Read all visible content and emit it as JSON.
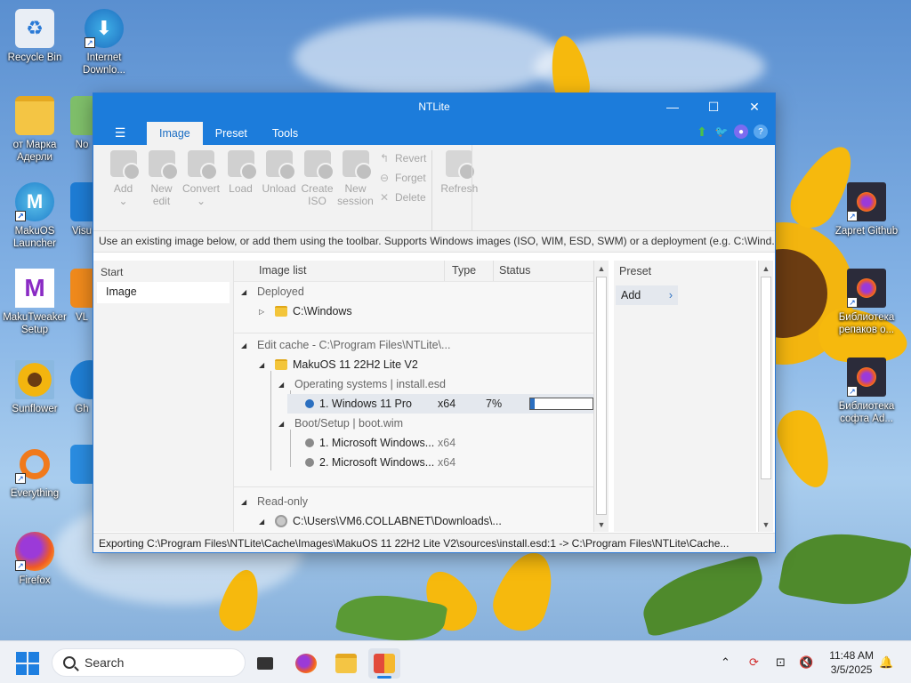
{
  "desktop": {
    "icons_left": [
      {
        "label": "Recycle Bin",
        "icon": "recycle-bin-icon"
      },
      {
        "label": "Internet Downlo...",
        "icon": "internet-download-manager-icon"
      },
      {
        "label": "от Марка Адерли",
        "icon": "folder-icon"
      },
      {
        "label": "No",
        "icon": "notepad-icon"
      },
      {
        "label": "MakuOS Launcher",
        "icon": "makuos-launcher-icon"
      },
      {
        "label": "Visu",
        "icon": "visual-studio-icon"
      },
      {
        "label": "MakuTweaker Setup",
        "icon": "makutweaker-icon"
      },
      {
        "label": "VL",
        "icon": "vlc-icon"
      },
      {
        "label": "Sunflower",
        "icon": "sunflower-image-icon"
      },
      {
        "label": "Gh",
        "icon": "github-icon"
      },
      {
        "label": "Everything",
        "icon": "everything-search-icon"
      },
      {
        "label": "Firefox",
        "icon": "firefox-icon"
      }
    ],
    "icons_right": [
      {
        "label": "Zapret Github",
        "icon": "firefox-file-icon"
      },
      {
        "label": "Библиотека репаков о...",
        "icon": "firefox-file-icon"
      },
      {
        "label": "Библиотека софта Ad...",
        "icon": "firefox-file-icon"
      }
    ]
  },
  "window": {
    "title": "NTLite",
    "tabs": [
      "Image",
      "Preset",
      "Tools"
    ],
    "active_tab": "Image",
    "ribbon": {
      "buttons": [
        {
          "label": "Add",
          "sub": "⌄"
        },
        {
          "label": "New",
          "sub": "edit"
        },
        {
          "label": "Convert",
          "sub": "⌄"
        },
        {
          "label": "Load",
          "sub": ""
        },
        {
          "label": "Unload",
          "sub": ""
        },
        {
          "label": "Create",
          "sub": "ISO"
        },
        {
          "label": "New",
          "sub": "session"
        }
      ],
      "small": [
        "Revert",
        "Forget",
        "Delete"
      ],
      "refresh": "Refresh"
    },
    "info": "Use an existing image below, or add them using the toolbar. Supports Windows images (ISO, WIM, ESD, SWM) or a deployment (e.g. C:\\Wind...",
    "left_pane": {
      "header": "Start",
      "item": "Image"
    },
    "columns": {
      "image_list": "Image list",
      "type": "Type",
      "status": "Status"
    },
    "tree": {
      "deployed": "Deployed",
      "deployed_item": "C:\\Windows",
      "edit_cache": "Edit cache - C:\\Program Files\\NTLite\\...",
      "makuos": "MakuOS 11 22H2 Lite V2",
      "os_group": "Operating systems  |  install.esd",
      "os_item": {
        "name": "1. Windows 11 Pro",
        "type": "x64",
        "status": "7%",
        "progress": 0.07
      },
      "boot_group": "Boot/Setup  |  boot.wim",
      "boot_items": [
        {
          "name": "1. Microsoft Windows...",
          "type": "x64"
        },
        {
          "name": "2. Microsoft Windows...",
          "type": "x64"
        }
      ],
      "readonly": "Read-only",
      "readonly_item": "C:\\Users\\VM6.COLLABNET\\Downloads\\..."
    },
    "preset": {
      "header": "Preset",
      "add": "Add"
    },
    "status": "Exporting C:\\Program Files\\NTLite\\Cache\\Images\\MakuOS 11 22H2 Lite V2\\sources\\install.esd:1 -> C:\\Program Files\\NTLite\\Cache..."
  },
  "taskbar": {
    "search_placeholder": "Search",
    "time": "11:48 AM",
    "date": "3/5/2025"
  }
}
